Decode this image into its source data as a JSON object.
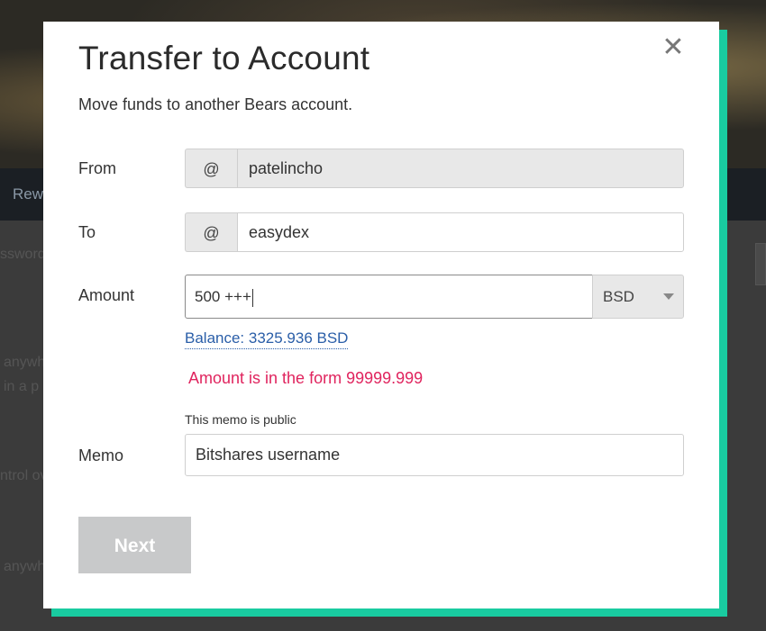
{
  "background": {
    "nav_item": "Rew",
    "text_lines": [
      "ssword",
      "anywh",
      "in a p",
      "ntrol ov",
      "anywh"
    ]
  },
  "modal": {
    "title": "Transfer to Account",
    "subtitle": "Move funds to another Bears account.",
    "close_symbol": "✕",
    "from": {
      "label": "From",
      "prefix": "@",
      "value": "patelincho"
    },
    "to": {
      "label": "To",
      "prefix": "@",
      "value": "easydex"
    },
    "amount": {
      "label": "Amount",
      "value": "500 +++",
      "asset": "BSD"
    },
    "balance": "Balance: 3325.936 BSD",
    "error": "Amount is in the form 99999.999",
    "memo": {
      "label": "Memo",
      "note": "This memo is public",
      "value": "Bitshares username"
    },
    "next_label": "Next"
  },
  "colors": {
    "accent_shadow": "#19cba0",
    "error": "#e0245e",
    "link": "#2a5ea8",
    "disabled_button": "#c8c9ca"
  }
}
